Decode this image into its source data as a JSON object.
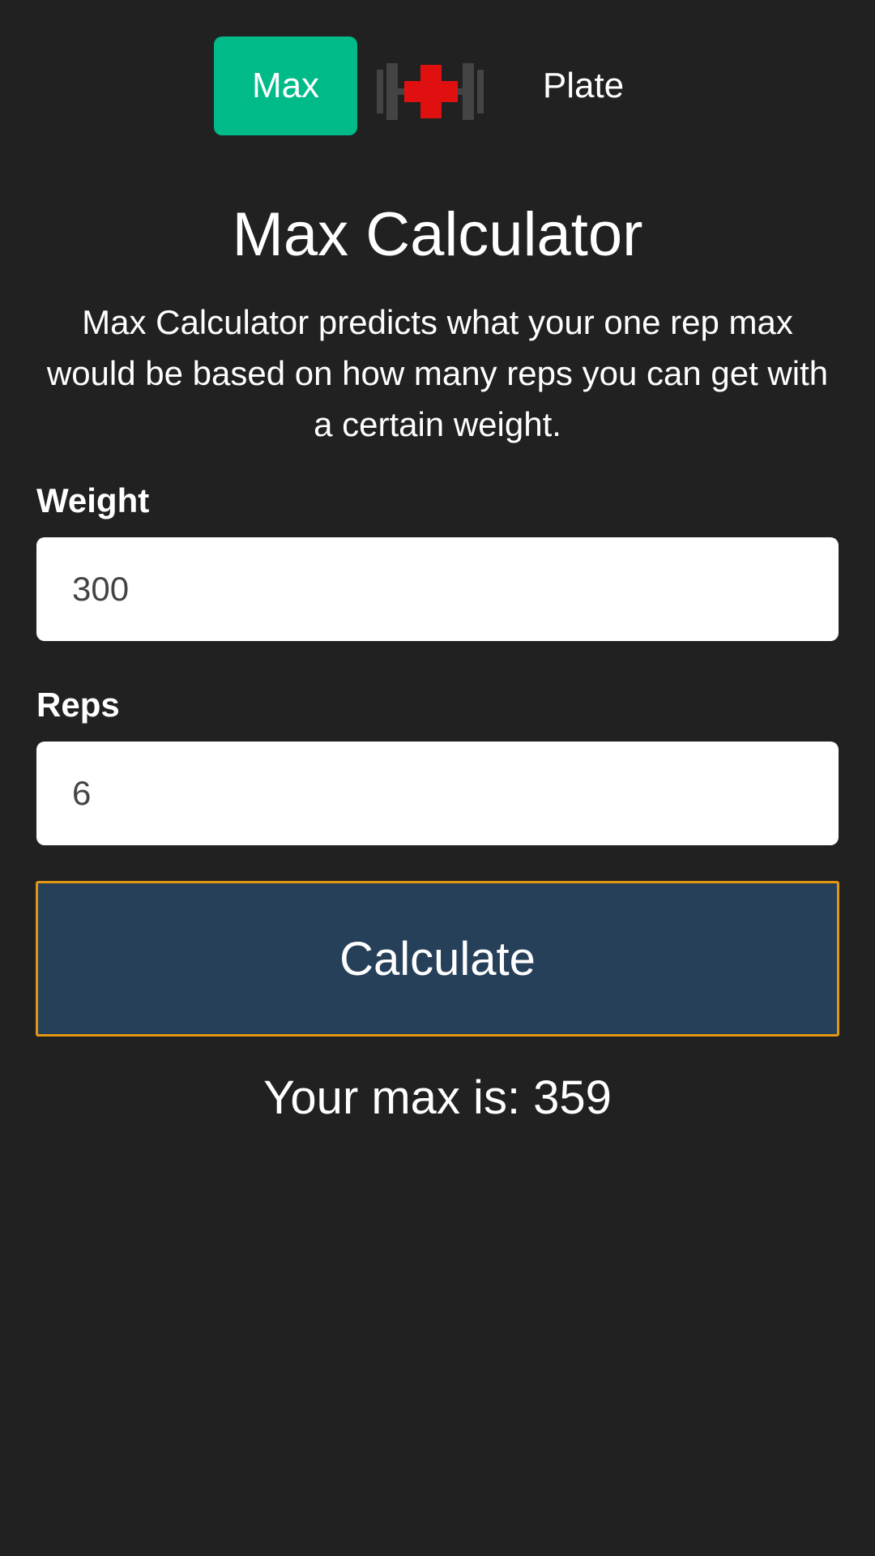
{
  "nav": {
    "max_tab_label": "Max",
    "plate_tab_label": "Plate",
    "logo_icon": "dumbbell-plus-icon"
  },
  "colors": {
    "background": "#212121",
    "active_tab": "#00bb88",
    "button_fill": "#27405a",
    "button_border": "#e3970f",
    "logo_cross": "#e01010",
    "logo_dumbbell": "#444444"
  },
  "main": {
    "title": "Max Calculator",
    "description": "Max Calculator predicts what your one rep max would be based on how many reps you can get with a certain weight."
  },
  "form": {
    "weight_label": "Weight",
    "weight_value": "300",
    "reps_label": "Reps",
    "reps_value": "6",
    "calculate_label": "Calculate"
  },
  "result": {
    "text": "Your max is: 359"
  }
}
